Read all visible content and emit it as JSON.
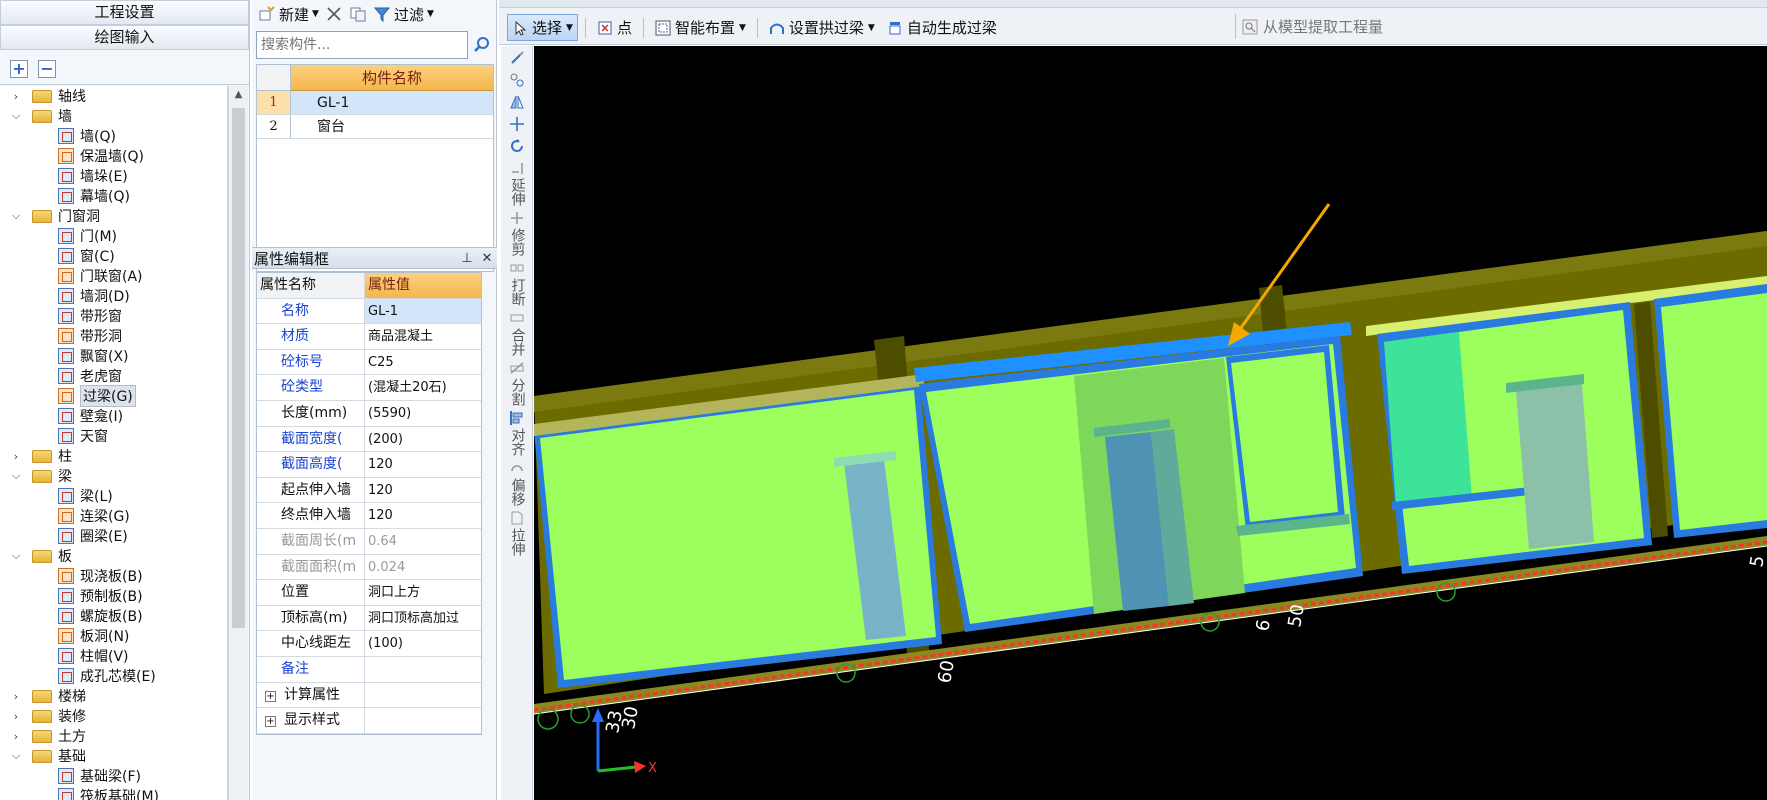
{
  "nav": {
    "project_settings": "工程设置",
    "drawing_input": "绘图输入",
    "expand_label": "+",
    "collapse_label": "−",
    "tree": [
      {
        "label": "轴线",
        "level": 0,
        "expanded": false
      },
      {
        "label": "墙",
        "level": 0,
        "expanded": true
      },
      {
        "label": "墙(Q)",
        "level": 1,
        "icon": "wall-icon"
      },
      {
        "label": "保温墙(Q)",
        "level": 1,
        "icon": "insulation-wall-icon"
      },
      {
        "label": "墙垛(E)",
        "level": 1,
        "icon": "wall-pier-icon"
      },
      {
        "label": "幕墙(Q)",
        "level": 1,
        "icon": "curtain-wall-icon"
      },
      {
        "label": "门窗洞",
        "level": 0,
        "expanded": true
      },
      {
        "label": "门(M)",
        "level": 1,
        "icon": "door-icon"
      },
      {
        "label": "窗(C)",
        "level": 1,
        "icon": "window-icon"
      },
      {
        "label": "门联窗(A)",
        "level": 1,
        "icon": "door-window-icon"
      },
      {
        "label": "墙洞(D)",
        "level": 1,
        "icon": "wall-hole-icon"
      },
      {
        "label": "带形窗",
        "level": 1,
        "icon": "strip-window-icon"
      },
      {
        "label": "带形洞",
        "level": 1,
        "icon": "strip-hole-icon"
      },
      {
        "label": "飘窗(X)",
        "level": 1,
        "icon": "bay-window-icon"
      },
      {
        "label": "老虎窗",
        "level": 1,
        "icon": "dormer-window-icon"
      },
      {
        "label": "过梁(G)",
        "level": 1,
        "icon": "lintel-icon",
        "selected": true
      },
      {
        "label": "壁龛(I)",
        "level": 1,
        "icon": "niche-icon"
      },
      {
        "label": "天窗",
        "level": 1,
        "icon": "skylight-icon"
      },
      {
        "label": "柱",
        "level": 0,
        "expanded": false
      },
      {
        "label": "梁",
        "level": 0,
        "expanded": true
      },
      {
        "label": "梁(L)",
        "level": 1,
        "icon": "beam-icon"
      },
      {
        "label": "连梁(G)",
        "level": 1,
        "icon": "coupling-beam-icon"
      },
      {
        "label": "圈梁(E)",
        "level": 1,
        "icon": "ring-beam-icon"
      },
      {
        "label": "板",
        "level": 0,
        "expanded": true
      },
      {
        "label": "现浇板(B)",
        "level": 1,
        "icon": "cast-slab-icon"
      },
      {
        "label": "预制板(B)",
        "level": 1,
        "icon": "precast-slab-icon"
      },
      {
        "label": "螺旋板(B)",
        "level": 1,
        "icon": "spiral-slab-icon"
      },
      {
        "label": "板洞(N)",
        "level": 1,
        "icon": "slab-hole-icon"
      },
      {
        "label": "柱帽(V)",
        "level": 1,
        "icon": "column-cap-icon"
      },
      {
        "label": "成孔芯模(E)",
        "level": 1,
        "icon": "hole-core-mold-icon"
      },
      {
        "label": "楼梯",
        "level": 0,
        "expanded": false
      },
      {
        "label": "装修",
        "level": 0,
        "expanded": false
      },
      {
        "label": "土方",
        "level": 0,
        "expanded": false
      },
      {
        "label": "基础",
        "level": 0,
        "expanded": true
      },
      {
        "label": "基础梁(F)",
        "level": 1,
        "icon": "foundation-beam-icon"
      },
      {
        "label": "筏板基础(M)",
        "level": 1,
        "icon": "raft-foundation-icon"
      }
    ]
  },
  "components": {
    "toolbar": {
      "new_label": "新建",
      "filter_label": "过滤"
    },
    "search": {
      "placeholder": "搜索构件..."
    },
    "table_header": "构件名称",
    "rows": [
      {
        "num": "1",
        "name": "GL-1",
        "selected": true
      },
      {
        "num": "2",
        "name": "窗台",
        "selected": false
      }
    ]
  },
  "properties": {
    "title": "属性编辑框",
    "header_key": "属性名称",
    "header_value": "属性值",
    "rows": [
      {
        "key": "名称",
        "value": "GL-1",
        "style": "blue",
        "selected": true
      },
      {
        "key": "材质",
        "value": "商品混凝土",
        "style": "blue"
      },
      {
        "key": "砼标号",
        "value": "C25",
        "style": "blue"
      },
      {
        "key": "砼类型",
        "value": "(混凝土20石)",
        "style": "blue"
      },
      {
        "key": "长度(mm)",
        "value": "(5590)",
        "style": "normal"
      },
      {
        "key": "截面宽度(",
        "value": "(200)",
        "style": "blue"
      },
      {
        "key": "截面高度(",
        "value": "120",
        "style": "blue"
      },
      {
        "key": "起点伸入墙",
        "value": "120",
        "style": "normal"
      },
      {
        "key": "终点伸入墙",
        "value": "120",
        "style": "normal"
      },
      {
        "key": "截面周长(m",
        "value": "0.64",
        "style": "gray"
      },
      {
        "key": "截面面积(m",
        "value": "0.024",
        "style": "gray"
      },
      {
        "key": "位置",
        "value": "洞口上方",
        "style": "normal"
      },
      {
        "key": "顶标高(m)",
        "value": "洞口顶标高加过",
        "style": "normal"
      },
      {
        "key": "中心线距左",
        "value": "(100)",
        "style": "normal"
      },
      {
        "key": "备注",
        "value": "",
        "style": "blue"
      },
      {
        "key": "计算属性",
        "value": "",
        "style": "group"
      },
      {
        "key": "显示样式",
        "value": "",
        "style": "group"
      }
    ]
  },
  "main_toolbar": {
    "select_label": "选择",
    "point_label": "点",
    "smart_layout_label": "智能布置",
    "arch_lintel_label": "设置拱过梁",
    "auto_lintel_label": "自动生成过梁",
    "extract_label": "从模型提取工程量"
  },
  "vtoolbar": {
    "extend": "延伸",
    "trim": "修剪",
    "break": "打断",
    "merge": "合并",
    "split": "分割",
    "align": "对齐",
    "offset": "偏移",
    "stretch": "拉伸"
  },
  "viewport": {
    "dim_labels": [
      "33",
      "30",
      "60",
      "6",
      "50",
      "5"
    ],
    "axis_x": "X",
    "colors": {
      "lintel": "#1e90ff",
      "wall": "#6b6b00",
      "opening": "#9cff5e",
      "arrow": "#f5a800"
    }
  }
}
